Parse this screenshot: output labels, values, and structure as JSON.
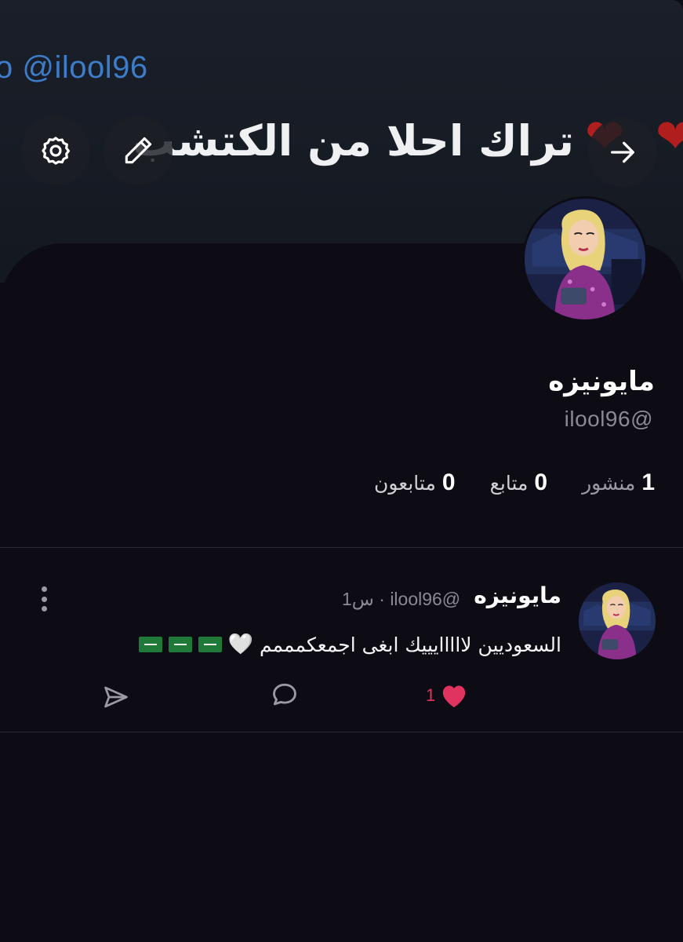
{
  "banner": {
    "mention": "o @ilool96",
    "text": "تراك احلا من الكتشب",
    "hearts": [
      "❤",
      "❤"
    ]
  },
  "toolbar": {
    "settings_icon": "gear-icon",
    "edit_icon": "pencil-icon",
    "forward_icon": "arrow-right-icon"
  },
  "profile": {
    "display_name": "مايونيزه",
    "handle": "ilool96@",
    "stats": [
      {
        "value": "0",
        "label": "متابعون"
      },
      {
        "value": "0",
        "label": "متابع"
      },
      {
        "value": "1",
        "label": "منشور"
      }
    ]
  },
  "post": {
    "author_name": "مايونيزه",
    "meta": "1س · ilool96@",
    "text": "السعوديين لااااايييك ابغى اجمعكمممم",
    "emoji": "🤍",
    "like_count": "1"
  },
  "colors": {
    "background": "#0d0c14",
    "banner_mention": "#3d7cc9",
    "like": "#e0335f",
    "muted_text": "#8a8a93"
  }
}
